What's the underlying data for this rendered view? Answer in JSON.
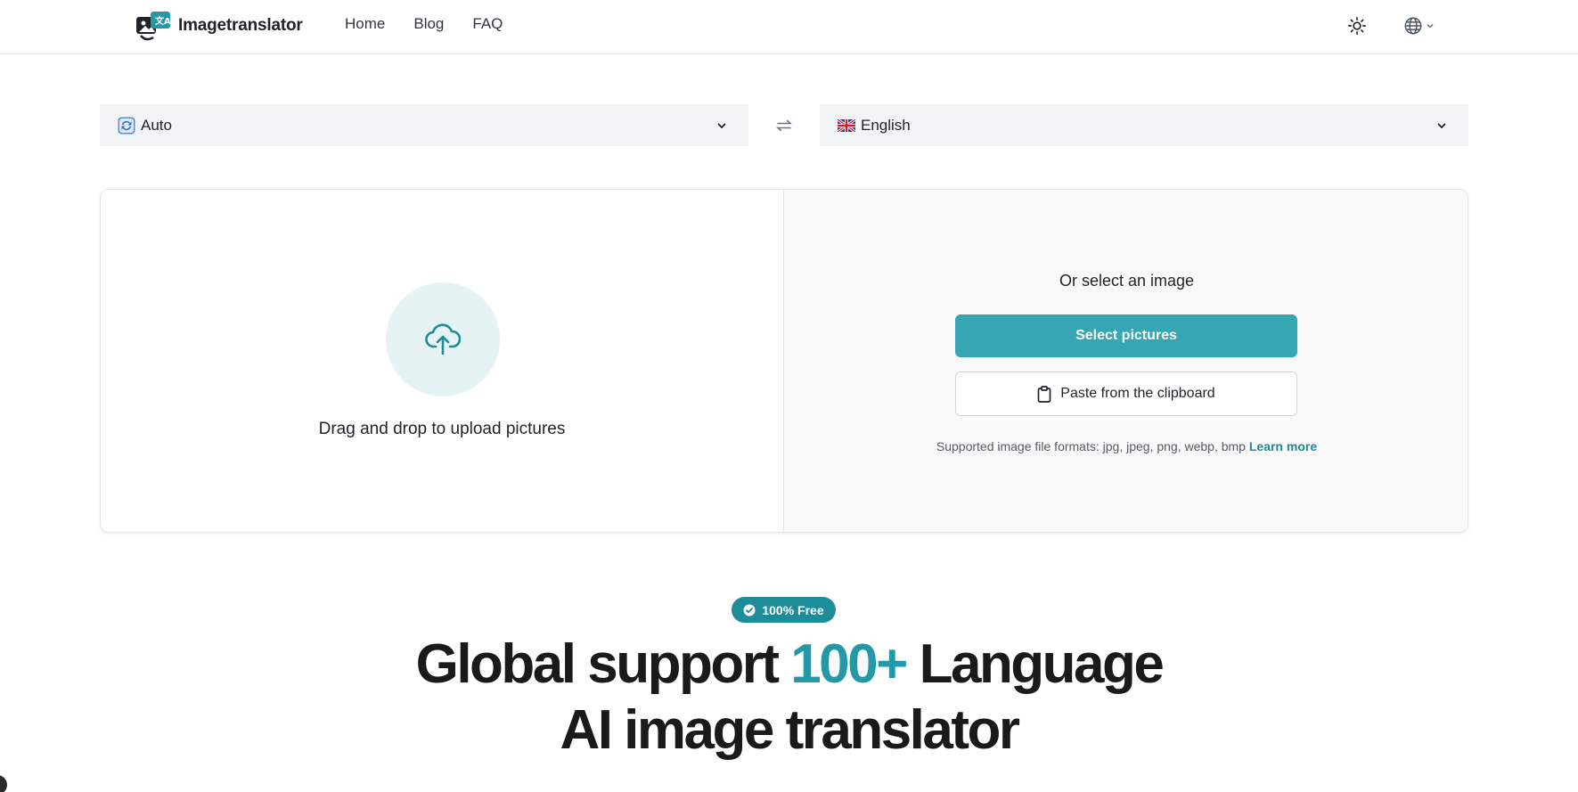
{
  "header": {
    "logo_text": "Imagetranslator",
    "nav": [
      {
        "label": "Home"
      },
      {
        "label": "Blog"
      },
      {
        "label": "FAQ"
      }
    ],
    "theme_icon": "sun-icon",
    "language_icon": "globe-icon"
  },
  "languages": {
    "source": {
      "value": "Auto",
      "icon": "auto-detect-icon"
    },
    "target": {
      "value": "English",
      "icon": "uk-flag-icon"
    },
    "swap_icon": "swap-arrows-icon"
  },
  "upload": {
    "drop_text": "Drag and drop to upload pictures",
    "or_text": "Or select an image",
    "select_button": "Select pictures",
    "paste_button": "Paste from the clipboard",
    "formats_text": "Supported image file formats: jpg, jpeg, png, webp, bmp",
    "learn_more": "Learn more"
  },
  "hero": {
    "badge": "100% Free",
    "line1_before": "Global support ",
    "line1_accent": "100+",
    "line1_after": " Language",
    "line2": "AI image translator"
  },
  "colors": {
    "primary": "#35a6b2",
    "accent_text": "#2398a6",
    "badge": "#1e8d9a",
    "link": "#1d8a98",
    "upload_circle_bg": "#e6f3f4"
  }
}
